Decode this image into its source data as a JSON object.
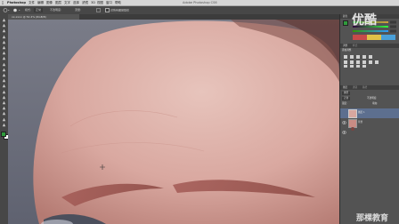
{
  "menu": {
    "items": [
      "Photoshop",
      "文件",
      "编辑",
      "图像",
      "图层",
      "文字",
      "选择",
      "滤镜",
      "3D",
      "视图",
      "窗口",
      "帮助"
    ],
    "app_title": "Adobe Photoshop CS6"
  },
  "options_bar": {
    "items": [
      "模式:",
      "正常",
      "不透明度:",
      "流量:",
      "对所有图层取样"
    ]
  },
  "document": {
    "tab_label": "xx-xxxx @ 52.4% (RGB/8)"
  },
  "panels": {
    "color_tabs": [
      "颜色",
      "色板"
    ],
    "adjust_tabs": [
      "调整",
      "样式"
    ],
    "adjust_label": "添加调整",
    "layers_tabs": [
      "图层",
      "通道",
      "路径"
    ],
    "kind_label": "类型",
    "blend_mode": "正常",
    "opacity_label": "不透明度:",
    "lock_label": "锁定:",
    "fill_label": "填充:",
    "layer_names": [
      "图层 1",
      "背景"
    ]
  },
  "watermark": {
    "top_right": "优酷",
    "bottom_right": "那棵教育"
  },
  "colors": {
    "foreground": "#2f9b3c",
    "background": "#ffffff"
  }
}
